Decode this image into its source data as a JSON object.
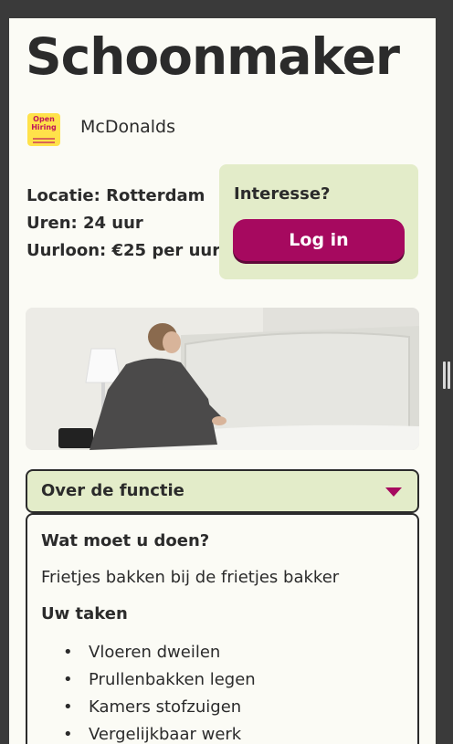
{
  "job": {
    "title": "Schoonmaker",
    "company": "McDonalds",
    "logo_text": "Open Hiring",
    "location": "Locatie: Rotterdam",
    "hours": "Uren: 24 uur",
    "wage": "Uurloon: €25 per uur"
  },
  "interest": {
    "label": "Interesse?",
    "login_label": "Log in"
  },
  "accordion": {
    "header": "Over de functie",
    "what_heading": "Wat moet u doen?",
    "what_text": "Frietjes bakken bij de frietjes bakker",
    "tasks_heading": "Uw taken",
    "tasks": [
      "Vloeren dweilen",
      "Prullenbakken legen",
      "Kamers stofzuigen",
      "Vergelijkbaar werk"
    ]
  },
  "colors": {
    "accent": "#a6095f",
    "panel": "#e3ecc9",
    "background": "#fbfbf5",
    "text": "#2b2b2b"
  },
  "icons": {
    "accordion_toggle": "caret-down-icon"
  }
}
